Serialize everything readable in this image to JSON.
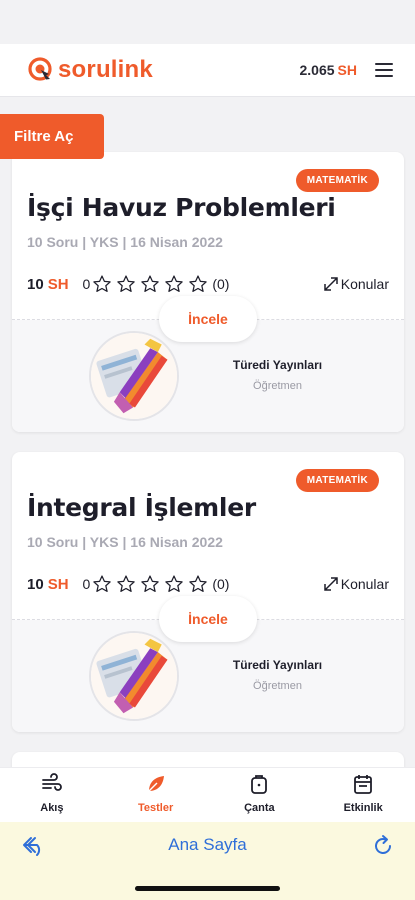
{
  "header": {
    "logo_text": "sorulink",
    "balance_value": "2.065",
    "balance_unit": "SH"
  },
  "filter_button": "Filtre Aç",
  "cards": [
    {
      "subject": "MATEMATİK",
      "title": "İşçi Havuz Problemleri",
      "meta": "10 Soru | YKS | 16 Nisan 2022",
      "price_value": "10",
      "price_unit": "SH",
      "rating_value": "0",
      "rating_stars": 0,
      "rating_count": "(0)",
      "topics_label": "Konular",
      "action_label": "İncele",
      "publisher_name": "Türedi Yayınları",
      "publisher_role": "Öğretmen"
    },
    {
      "subject": "MATEMATİK",
      "title": "İntegral İşlemler",
      "meta": "10 Soru | YKS | 16 Nisan 2022",
      "price_value": "10",
      "price_unit": "SH",
      "rating_value": "0",
      "rating_stars": 0,
      "rating_count": "(0)",
      "topics_label": "Konular",
      "action_label": "İncele",
      "publisher_name": "Türedi Yayınları",
      "publisher_role": "Öğretmen"
    }
  ],
  "tabs": [
    {
      "label": "Akış",
      "icon": "wind-icon",
      "active": false
    },
    {
      "label": "Testler",
      "icon": "leaf-icon",
      "active": true
    },
    {
      "label": "Çanta",
      "icon": "backpack-icon",
      "active": false
    },
    {
      "label": "Etkinlik",
      "icon": "calendar-icon",
      "active": false
    }
  ],
  "browser_bar": {
    "home_label": "Ana Sayfa"
  },
  "colors": {
    "accent": "#ef5b2b",
    "link": "#2f6fd8",
    "browser_bg": "#fbf9df"
  }
}
